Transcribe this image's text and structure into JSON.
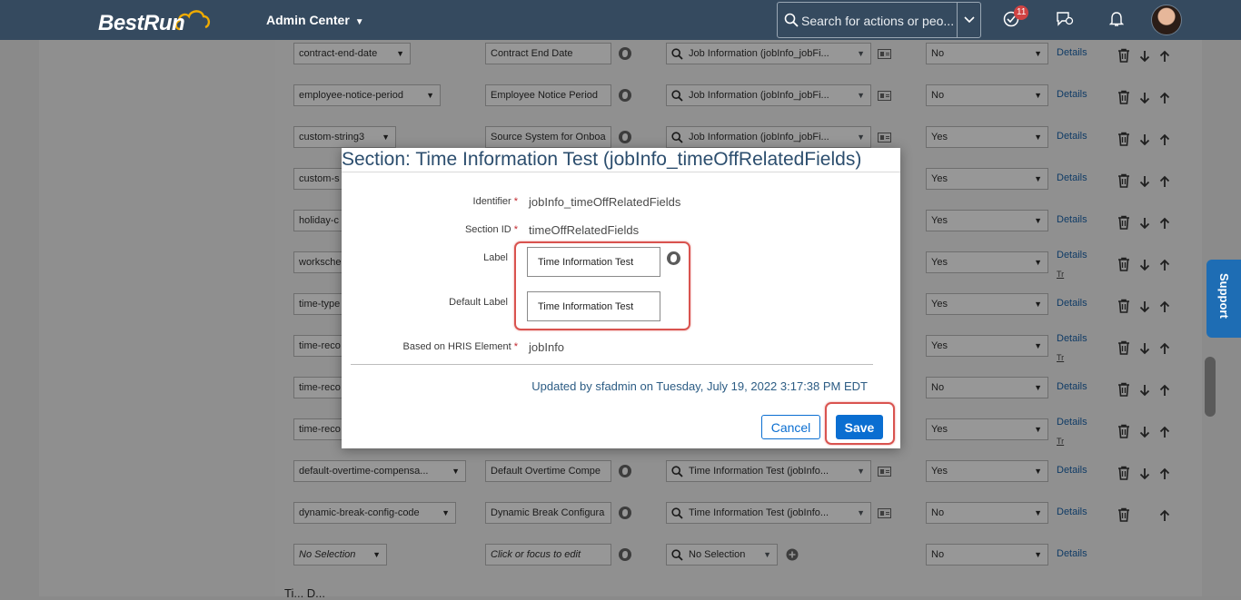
{
  "shell": {
    "logo": "BestRun",
    "app_menu": "Admin Center",
    "search_placeholder": "Search for actions or peo...",
    "notification_count": "11",
    "support": "Support"
  },
  "rows": [
    {
      "field": "contract-end-date",
      "label": "Contract End Date",
      "lookup": "Job Information (jobInfo_jobFi...",
      "visible": "No",
      "details": "Details",
      "tr": ""
    },
    {
      "field": "employee-notice-period",
      "label": "Employee Notice Period",
      "lookup": "Job Information (jobInfo_jobFi...",
      "visible": "No",
      "details": "Details",
      "tr": ""
    },
    {
      "field": "custom-string3",
      "label": "Source System for Onboa",
      "lookup": "Job Information (jobInfo_jobFi...",
      "visible": "Yes",
      "details": "Details",
      "tr": ""
    },
    {
      "field": "custom-s",
      "label": "",
      "lookup": "",
      "visible": "Yes",
      "details": "Details",
      "tr": ""
    },
    {
      "field": "holiday-c",
      "label": "",
      "lookup": "",
      "visible": "Yes",
      "details": "Details",
      "tr": ""
    },
    {
      "field": "worksche",
      "label": "",
      "lookup": "",
      "visible": "Yes",
      "details": "Details",
      "tr": "Tr"
    },
    {
      "field": "time-type",
      "label": "",
      "lookup": "",
      "visible": "Yes",
      "details": "Details",
      "tr": ""
    },
    {
      "field": "time-reco",
      "label": "",
      "lookup": "",
      "visible": "Yes",
      "details": "Details",
      "tr": "Tr"
    },
    {
      "field": "time-reco",
      "label": "",
      "lookup": "",
      "visible": "No",
      "details": "Details",
      "tr": ""
    },
    {
      "field": "time-reco",
      "label": "",
      "lookup": "",
      "visible": "Yes",
      "details": "Details",
      "tr": "Tr"
    },
    {
      "field": "default-overtime-compensa...",
      "label": "Default Overtime Compe",
      "lookup": "Time Information Test (jobInfo...",
      "visible": "Yes",
      "details": "Details",
      "tr": ""
    },
    {
      "field": "dynamic-break-config-code",
      "label": "Dynamic Break Configura",
      "lookup": "Time Information Test (jobInfo...",
      "visible": "No",
      "details": "Details",
      "tr": ""
    },
    {
      "field": "No Selection",
      "label": "Click or focus to edit",
      "lookup": "No Selection",
      "visible": "No",
      "details": "Details",
      "tr": ""
    }
  ],
  "bottom_text": "Ti... D...",
  "dialog": {
    "title": "Section: Time Information Test (jobInfo_timeOffRelatedFields)",
    "identifier_label": "Identifier",
    "identifier_value": "jobInfo_timeOffRelatedFields",
    "section_id_label": "Section ID",
    "section_id_value": "timeOffRelatedFields",
    "label_label": "Label",
    "label_value": "Time Information Test",
    "default_label_label": "Default Label",
    "default_label_value": "Time Information Test",
    "hris_label": "Based on HRIS Element",
    "hris_value": "jobInfo",
    "updated": "Updated by sfadmin on Tuesday, July 19, 2022 3:17:38 PM EDT",
    "cancel": "Cancel",
    "save": "Save"
  },
  "colors": {
    "shell": "#354a5f",
    "accent": "#0a6ed1",
    "highlight": "#d9534f"
  }
}
